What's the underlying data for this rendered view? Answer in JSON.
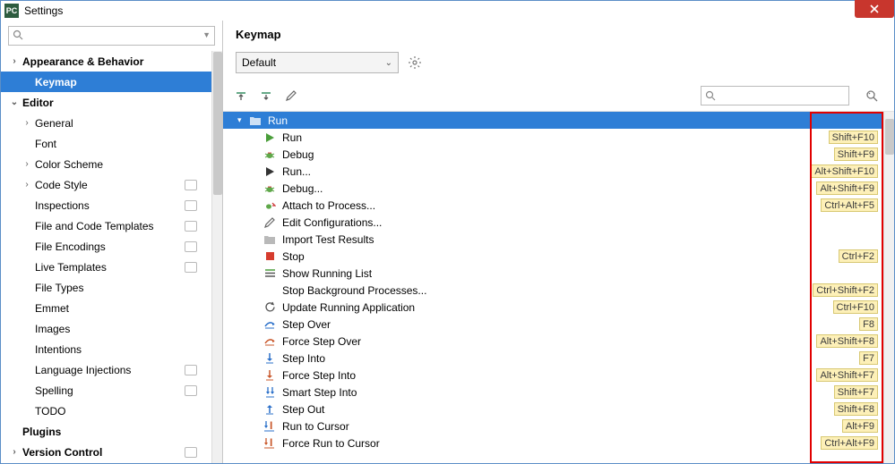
{
  "window": {
    "title": "Settings",
    "app_icon_text": "PC"
  },
  "sidebar": {
    "search_placeholder": "",
    "items": [
      {
        "label": "Appearance & Behavior",
        "chev": "›",
        "bold": true,
        "indent": 0
      },
      {
        "label": "Keymap",
        "bold": true,
        "indent": 1,
        "selected": true
      },
      {
        "label": "Editor",
        "chev": "⌄",
        "bold": true,
        "indent": 0
      },
      {
        "label": "General",
        "chev": "›",
        "indent": 1
      },
      {
        "label": "Font",
        "indent": 2
      },
      {
        "label": "Color Scheme",
        "chev": "›",
        "indent": 1
      },
      {
        "label": "Code Style",
        "chev": "›",
        "indent": 1,
        "badge": true
      },
      {
        "label": "Inspections",
        "indent": 2,
        "badge": true
      },
      {
        "label": "File and Code Templates",
        "indent": 2,
        "badge": true
      },
      {
        "label": "File Encodings",
        "indent": 2,
        "badge": true
      },
      {
        "label": "Live Templates",
        "indent": 2,
        "badge": true
      },
      {
        "label": "File Types",
        "indent": 2
      },
      {
        "label": "Emmet",
        "indent": 2
      },
      {
        "label": "Images",
        "indent": 2
      },
      {
        "label": "Intentions",
        "indent": 2
      },
      {
        "label": "Language Injections",
        "indent": 2,
        "badge": true
      },
      {
        "label": "Spelling",
        "indent": 2,
        "badge": true
      },
      {
        "label": "TODO",
        "indent": 2
      },
      {
        "label": "Plugins",
        "bold": true,
        "indent": 0
      },
      {
        "label": "Version Control",
        "chev": "›",
        "bold": true,
        "indent": 0,
        "badge": true
      }
    ]
  },
  "main": {
    "title": "Keymap",
    "scheme": "Default",
    "action_search_placeholder": ""
  },
  "tree": {
    "header": {
      "label": "Run",
      "icon": "folder",
      "selected": true
    },
    "rows": [
      {
        "label": "Run",
        "icon": "play-green",
        "shortcut": "Shift+F10"
      },
      {
        "label": "Debug",
        "icon": "bug",
        "shortcut": "Shift+F9"
      },
      {
        "label": "Run...",
        "icon": "play-black",
        "shortcut": "Alt+Shift+F10"
      },
      {
        "label": "Debug...",
        "icon": "bug",
        "shortcut": "Alt+Shift+F9"
      },
      {
        "label": "Attach to Process...",
        "icon": "bug-attach",
        "shortcut": "Ctrl+Alt+F5"
      },
      {
        "label": "Edit Configurations...",
        "icon": "pencil"
      },
      {
        "label": "Import Test Results",
        "icon": "folder-gray"
      },
      {
        "label": "Stop",
        "icon": "stop-red",
        "shortcut": "Ctrl+F2"
      },
      {
        "label": "Show Running List",
        "icon": "list"
      },
      {
        "label": "Stop Background Processes...",
        "icon": "",
        "shortcut": "Ctrl+Shift+F2"
      },
      {
        "label": "Update Running Application",
        "icon": "refresh",
        "shortcut": "Ctrl+F10"
      },
      {
        "label": "Step Over",
        "icon": "step-over",
        "shortcut": "F8"
      },
      {
        "label": "Force Step Over",
        "icon": "force-step-over",
        "shortcut": "Alt+Shift+F8"
      },
      {
        "label": "Step Into",
        "icon": "step-into",
        "shortcut": "F7"
      },
      {
        "label": "Force Step Into",
        "icon": "force-step-into",
        "shortcut": "Alt+Shift+F7"
      },
      {
        "label": "Smart Step Into",
        "icon": "smart-step-into",
        "shortcut": "Shift+F7"
      },
      {
        "label": "Step Out",
        "icon": "step-out",
        "shortcut": "Shift+F8"
      },
      {
        "label": "Run to Cursor",
        "icon": "run-to-cursor",
        "shortcut": "Alt+F9"
      },
      {
        "label": "Force Run to Cursor",
        "icon": "force-run-to-cursor",
        "shortcut": "Ctrl+Alt+F9"
      }
    ]
  }
}
